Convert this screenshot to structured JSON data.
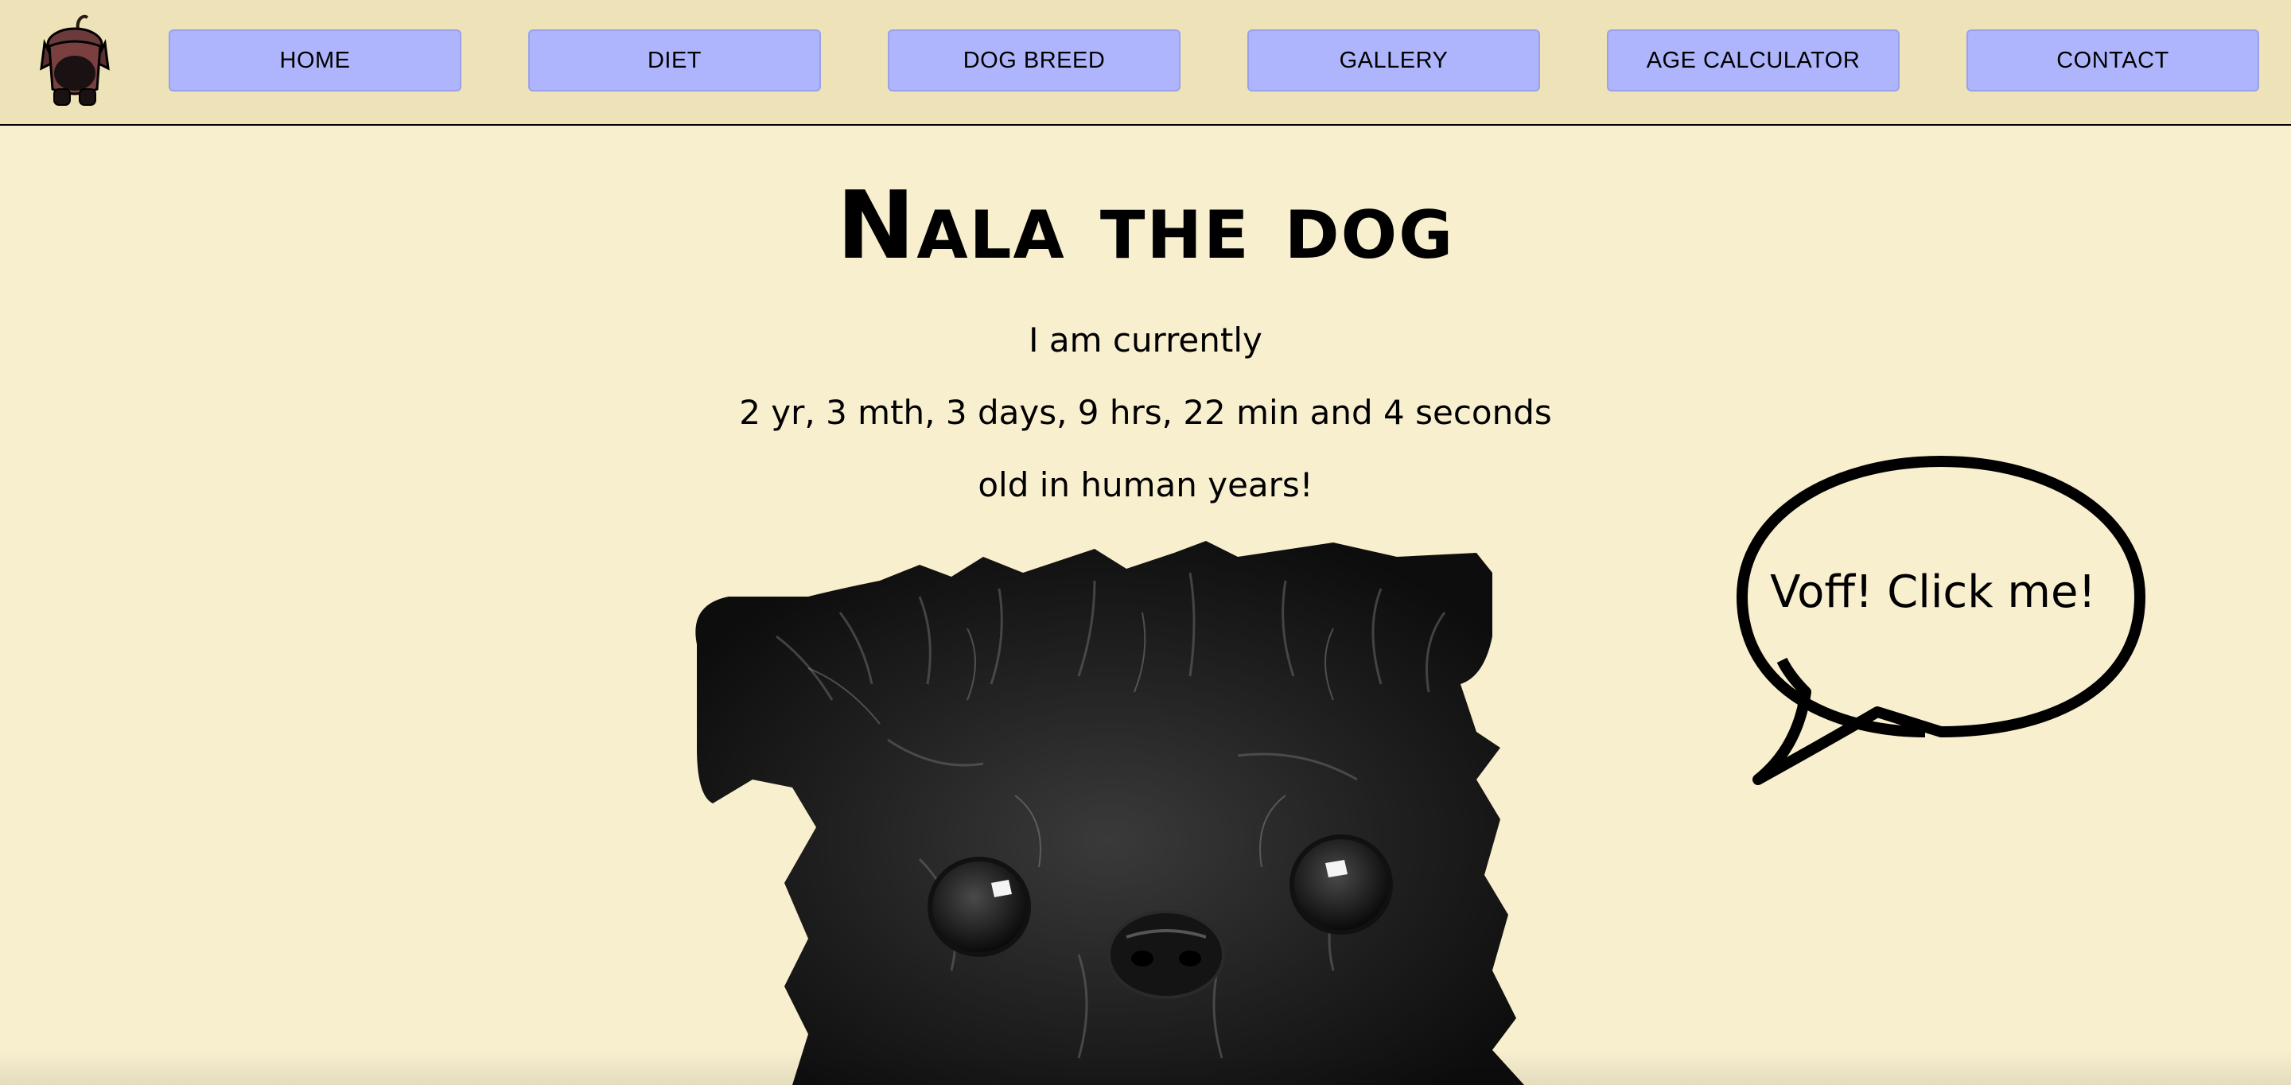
{
  "nav": {
    "logo_icon": "dog-logo-icon",
    "items": [
      {
        "label": "HOME"
      },
      {
        "label": "DIET"
      },
      {
        "label": "DOG BREED"
      },
      {
        "label": "GALLERY"
      },
      {
        "label": "AGE CALCULATOR"
      },
      {
        "label": "CONTACT"
      }
    ]
  },
  "main": {
    "title": "Nala the dog",
    "age_intro": "I am currently",
    "age_value": "2 yr, 3 mth, 3 days, 9 hrs, 22 min and 4 seconds",
    "age_outro": "old in human years!",
    "bubble_text": "Voff! Click me!",
    "dog_image": "dog-photo"
  },
  "colors": {
    "page_background": "#f8efcf",
    "navbar_background": "#eee2b9",
    "nav_button": "#aeb5fc"
  }
}
